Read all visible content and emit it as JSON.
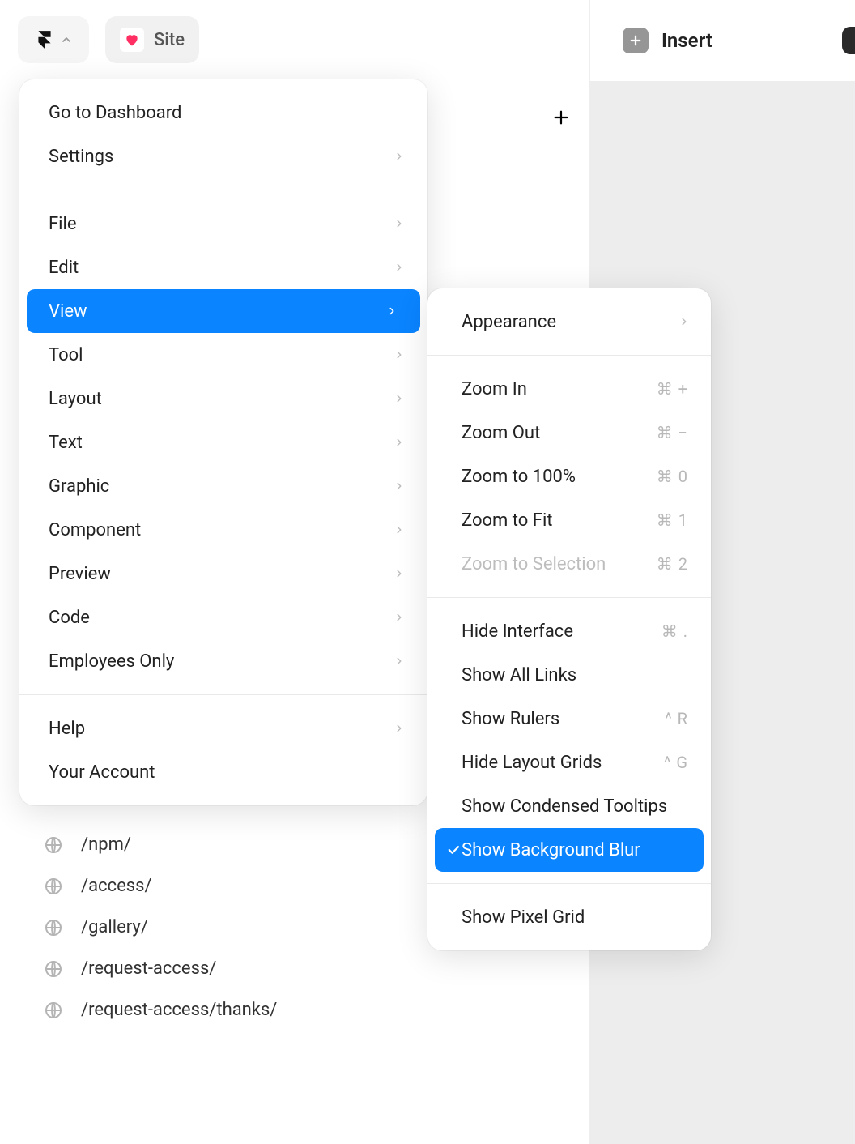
{
  "topbar": {
    "site_label": "Site",
    "insert_label": "Insert"
  },
  "main_menu": {
    "group1": [
      {
        "label": "Go to Dashboard",
        "has_submenu": false
      },
      {
        "label": "Settings",
        "has_submenu": true
      }
    ],
    "group2": [
      {
        "label": "File",
        "has_submenu": true
      },
      {
        "label": "Edit",
        "has_submenu": true
      },
      {
        "label": "View",
        "has_submenu": true,
        "highlight": true
      },
      {
        "label": "Tool",
        "has_submenu": true
      },
      {
        "label": "Layout",
        "has_submenu": true
      },
      {
        "label": "Text",
        "has_submenu": true
      },
      {
        "label": "Graphic",
        "has_submenu": true
      },
      {
        "label": "Component",
        "has_submenu": true
      },
      {
        "label": "Preview",
        "has_submenu": true
      },
      {
        "label": "Code",
        "has_submenu": true
      },
      {
        "label": "Employees Only",
        "has_submenu": true
      }
    ],
    "group3": [
      {
        "label": "Help",
        "has_submenu": true
      },
      {
        "label": "Your Account",
        "has_submenu": false
      }
    ]
  },
  "view_submenu": {
    "group1": [
      {
        "label": "Appearance",
        "has_submenu": true
      }
    ],
    "group2": [
      {
        "label": "Zoom In",
        "shortcut": "⌘ +"
      },
      {
        "label": "Zoom Out",
        "shortcut": "⌘ −"
      },
      {
        "label": "Zoom to 100%",
        "shortcut": "⌘ 0"
      },
      {
        "label": "Zoom to Fit",
        "shortcut": "⌘ 1"
      },
      {
        "label": "Zoom to Selection",
        "shortcut": "⌘ 2",
        "disabled": true
      }
    ],
    "group3": [
      {
        "label": "Hide Interface",
        "shortcut": "⌘ ."
      },
      {
        "label": "Show All Links"
      },
      {
        "label": "Show Rulers",
        "shortcut": "^ R"
      },
      {
        "label": "Hide Layout Grids",
        "shortcut": "^ G"
      },
      {
        "label": "Show Condensed Tooltips"
      },
      {
        "label": "Show Background Blur",
        "checked": true,
        "highlight": true
      }
    ],
    "group4": [
      {
        "label": "Show Pixel Grid"
      }
    ]
  },
  "pages": [
    "/npm/",
    "/access/",
    "/gallery/",
    "/request-access/",
    "/request-access/thanks/"
  ],
  "colors": {
    "accent": "#0a84ff",
    "heart": "#ff3366"
  }
}
